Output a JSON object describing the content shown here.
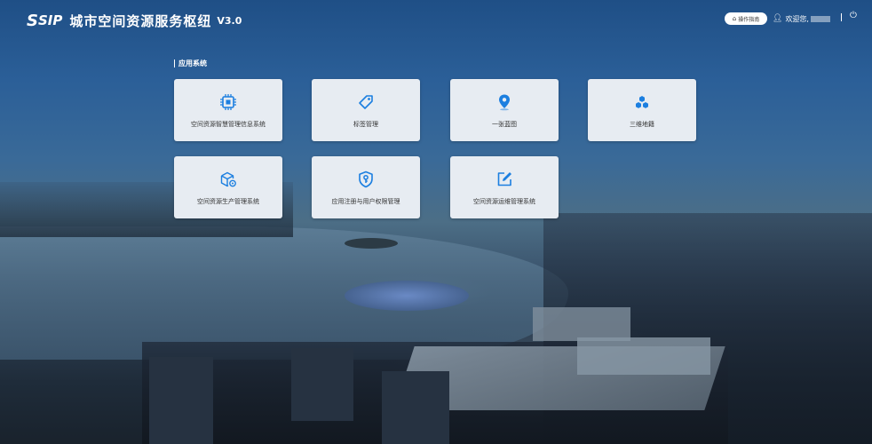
{
  "header": {
    "logo_mark": "S",
    "logo_text": "SIP",
    "title": "城市空间资源服务枢纽",
    "version": "V3.0",
    "guide_button": "操作指南",
    "welcome": "欢迎您,"
  },
  "section": {
    "title": "应用系统"
  },
  "apps": [
    {
      "label": "空间资源智慧管理信息系统",
      "icon": "chip-icon"
    },
    {
      "label": "标签管理",
      "icon": "tag-icon"
    },
    {
      "label": "一张蓝图",
      "icon": "location-pin-icon"
    },
    {
      "label": "三维地籍",
      "icon": "cubes-icon"
    },
    {
      "label": "空间资源生产管理系统",
      "icon": "box-gear-icon"
    },
    {
      "label": "应用注册与用户权限管理",
      "icon": "shield-key-icon"
    },
    {
      "label": "空间资源运维管理系统",
      "icon": "edit-icon"
    }
  ],
  "colors": {
    "accent": "#1c7fe0",
    "card_bg": "#e7ecf2"
  }
}
